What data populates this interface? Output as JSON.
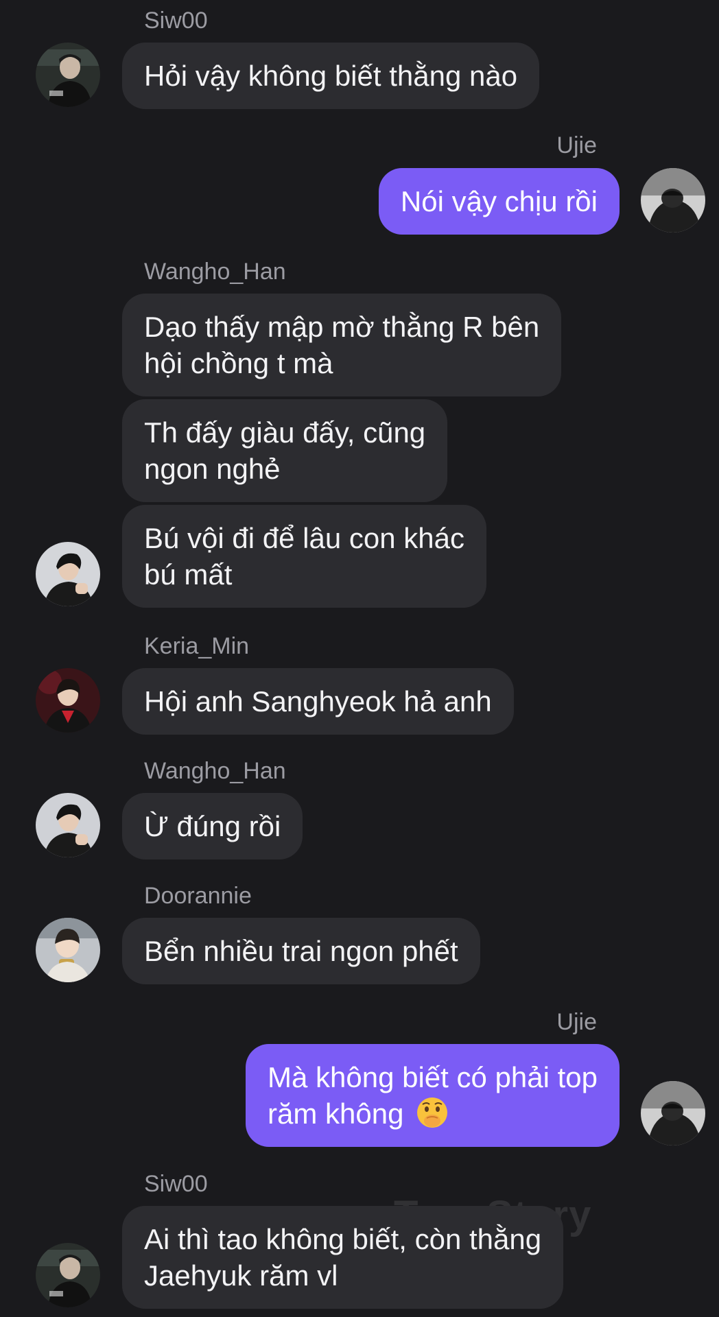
{
  "watermark": "TypeStory",
  "colors": {
    "background": "#1a1a1d",
    "incoming_bubble": "#2c2c30",
    "outgoing_bubble": "#7b5cf5",
    "sender_name": "#9c9ca3"
  },
  "messages": [
    {
      "sender": "Siw00",
      "direction": "incoming",
      "text": "Hỏi vậy không biết thằng nào"
    },
    {
      "sender": "Ujie",
      "direction": "outgoing",
      "text": "Nói vậy chịu rồi"
    },
    {
      "sender": "Wangho_Han",
      "direction": "incoming",
      "lines": [
        "Dạo thấy mập mờ thằng R bên",
        "hội chồng t mà",
        "Th đấy giàu đấy, cũng",
        "ngon nghẻ",
        "Bú vội đi để lâu con khác",
        "bú mất"
      ]
    },
    {
      "sender": "Keria_Min",
      "direction": "incoming",
      "text": "Hội anh Sanghyeok hả anh"
    },
    {
      "sender": "Wangho_Han",
      "direction": "incoming",
      "text": "Ừ đúng rồi"
    },
    {
      "sender": "Doorannie",
      "direction": "incoming",
      "text": "Bển nhiều trai ngon phết"
    },
    {
      "sender": "Ujie",
      "direction": "outgoing",
      "lines": [
        "Mà không biết có phải top",
        "răm không"
      ],
      "emoji": "shushing-face-emoji"
    },
    {
      "sender": "Siw00",
      "direction": "incoming",
      "lines": [
        "Ai thì tao không biết, còn thằng",
        "Jaehyuk răm vl"
      ]
    }
  ]
}
